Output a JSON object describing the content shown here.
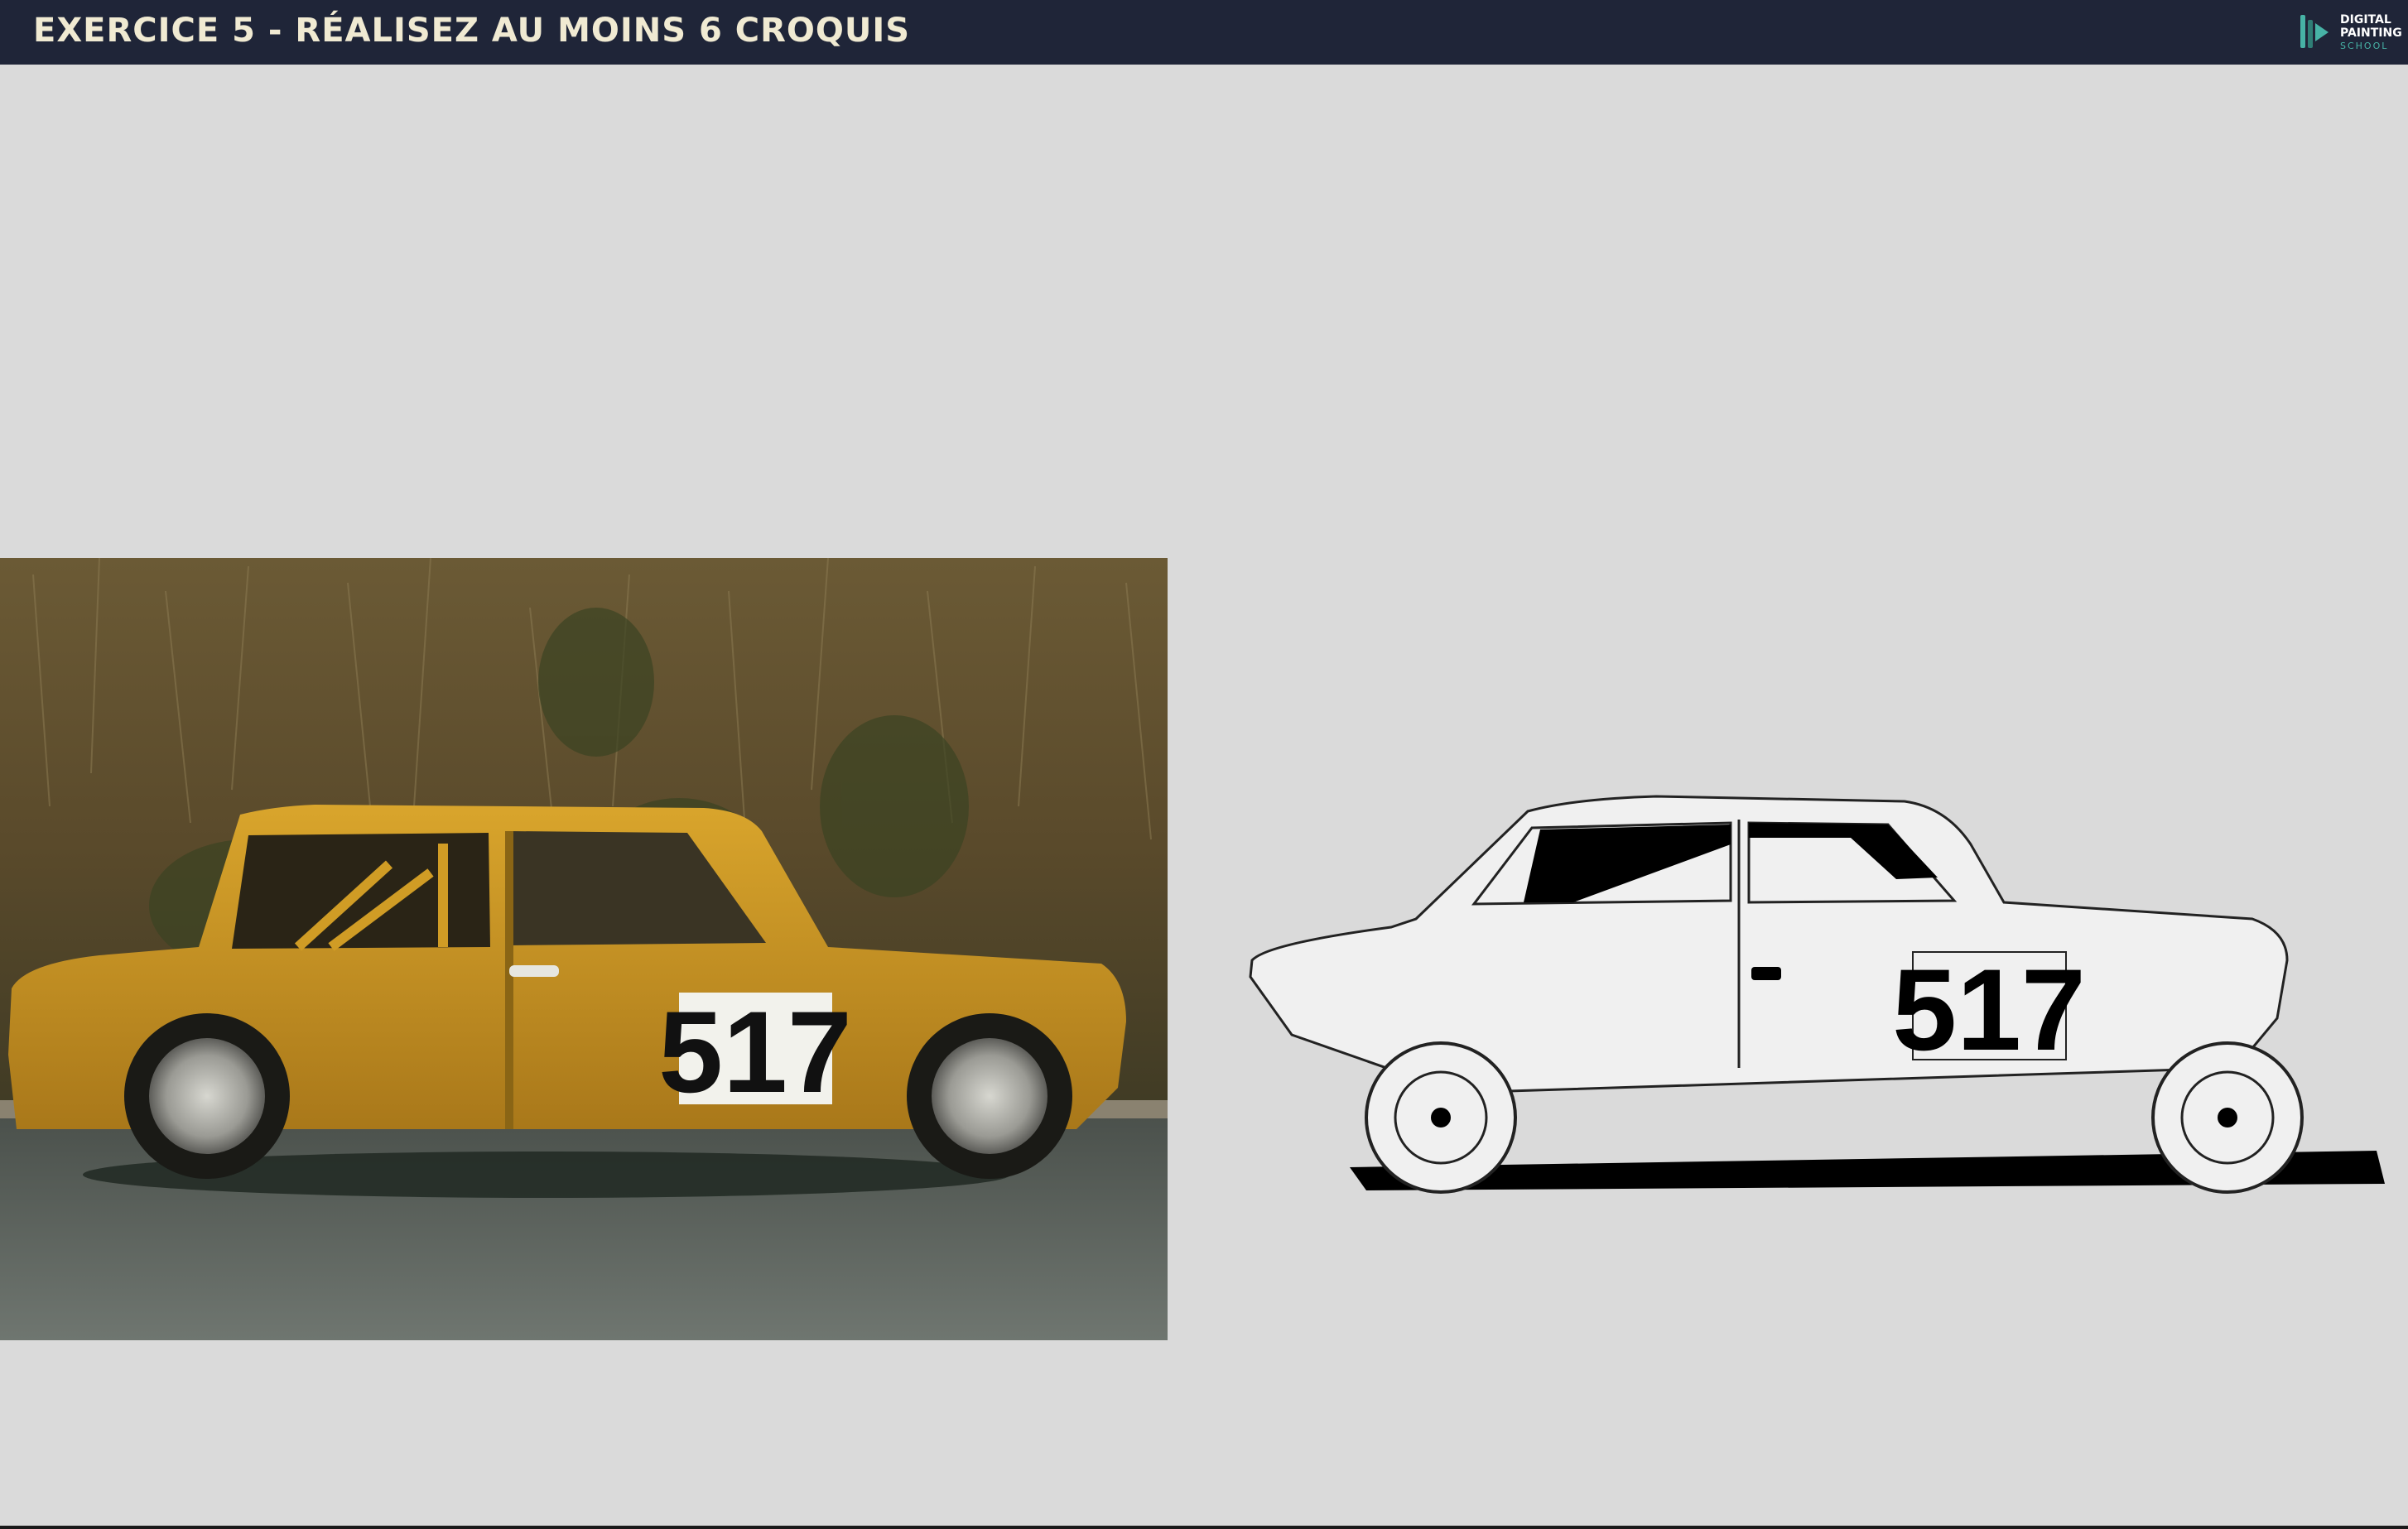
{
  "header": {
    "title": "EXERCICE 5 - RÉALISEZ AU MOINS 6 CROQUIS",
    "logo": {
      "line1": "DIGITAL",
      "line2": "PAINTING",
      "line3": "SCHOOL"
    }
  },
  "photo": {
    "race_number": "517"
  },
  "drawing": {
    "race_number": "517"
  },
  "colors": {
    "header_bg": "#1f2538",
    "title": "#f0ead2",
    "background": "#dadada",
    "car_body": "#c99520",
    "logo_accent": "#47b3a6"
  }
}
